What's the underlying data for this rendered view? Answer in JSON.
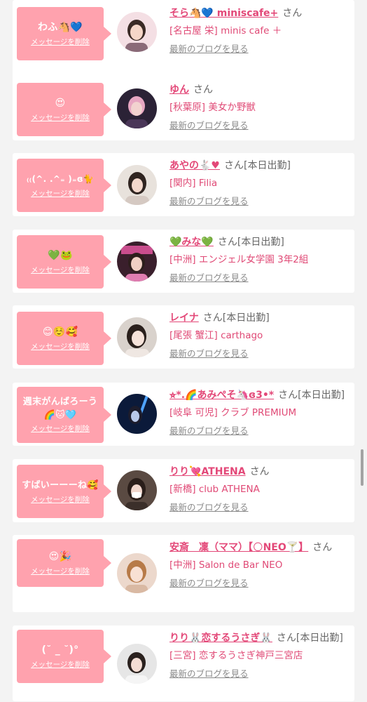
{
  "colors": {
    "page_bg": "#f3f3f3",
    "card_bg": "#ffffff",
    "bubble_bg": "#ffa2ae",
    "name_pink": "#e34878",
    "shop_pink": "#e04a76",
    "link_grey": "#8a8a8a"
  },
  "items": [
    {
      "message": "わふ🐴💙",
      "delete_label": "メッセージを削除",
      "name": "そら🐴💙 miniscafe+",
      "honorific": "さん",
      "status": "",
      "shop": "[名古屋 栄] minis cafe ＋",
      "blog_label": "最新のブログを見る",
      "avatar_icon": "profile-photo"
    },
    {
      "message": "😍",
      "delete_label": "メッセージを削除",
      "name": "ゆん",
      "honorific": "さん",
      "status": "",
      "shop": "[秋葉原] 美女か野獣",
      "blog_label": "最新のブログを見る",
      "avatar_icon": "profile-photo"
    },
    {
      "message": "₍₍(^. .^₌ )₌ɞ🐈",
      "delete_label": "メッセージを削除",
      "name": "あやの🐇♥",
      "honorific": "さん",
      "status": "[本日出勤]",
      "shop": "[関内] Filia",
      "blog_label": "最新のブログを見る",
      "avatar_icon": "profile-photo"
    },
    {
      "message": "💚🐸",
      "delete_label": "メッセージを削除",
      "name": "💚みな💚",
      "honorific": "さん",
      "status": "[本日出勤]",
      "shop": "[中洲] エンジェル女学園 3年2組",
      "blog_label": "最新のブログを見る",
      "avatar_icon": "profile-photo"
    },
    {
      "message": "😊☺️🥰",
      "delete_label": "メッセージを削除",
      "name": "レイナ",
      "honorific": "さん",
      "status": "[本日出勤]",
      "shop": "[尾張 蟹江] carthago",
      "blog_label": "最新のブログを見る",
      "avatar_icon": "profile-photo"
    },
    {
      "message": "週末がんばろーう🌈🐱🩵",
      "delete_label": "メッセージを削除",
      "name": "⭐︎*.🌈あみぺそ🦄ɞ3•*",
      "honorific": "さん",
      "status": "[本日出勤]",
      "shop": "[岐阜 可児] クラブ PREMIUM",
      "blog_label": "最新のブログを見る",
      "avatar_icon": "profile-photo"
    },
    {
      "message": "すばいーーーね🥰",
      "delete_label": "メッセージを削除",
      "name": "りり💘ATHENA",
      "honorific": "さん",
      "status": "",
      "shop": "[新橋] club ATHENA",
      "blog_label": "最新のブログを見る",
      "avatar_icon": "profile-photo"
    },
    {
      "message": "😍🎉",
      "delete_label": "メッセージを削除",
      "name": "安斎　凜（ママ）【🌕NEO🍸】",
      "honorific": "さん",
      "status": "",
      "shop": "[中洲] Salon de Bar NEO",
      "blog_label": "最新のブログを見る",
      "avatar_icon": "profile-photo"
    },
    {
      "message": "(˘ _ ˘)°",
      "delete_label": "メッセージを削除",
      "name": "りり🐰恋するうさぎ🐰",
      "honorific": "さん",
      "status": "[本日出勤]",
      "shop": "[三宮] 恋するうさぎ神戸三宮店",
      "blog_label": "最新のブログを見る",
      "avatar_icon": "profile-photo"
    }
  ]
}
